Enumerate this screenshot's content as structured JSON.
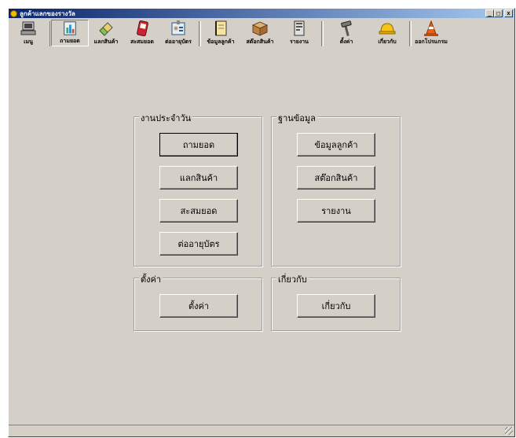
{
  "window": {
    "title": "ลูกค้าแลกของรางวัล",
    "controls": {
      "minimize": "_",
      "maximize": "□",
      "close": "x"
    }
  },
  "toolbar": {
    "items": [
      {
        "label": "เมนู",
        "icon": "computer-icon"
      },
      {
        "label": "ถามยอด",
        "icon": "chart-icon"
      },
      {
        "label": "แลกสินค้า",
        "icon": "eraser-icon"
      },
      {
        "label": "สะสมยอด",
        "icon": "pda-icon"
      },
      {
        "label": "ต่ออายุบัตร",
        "icon": "id-card-icon"
      },
      {
        "label": "ข้อมูลลูกค้า",
        "icon": "notebook-icon"
      },
      {
        "label": "สต๊อกสินค้า",
        "icon": "box-icon"
      },
      {
        "label": "รายงาน",
        "icon": "report-icon"
      },
      {
        "label": "ตั้งค่า",
        "icon": "hammer-icon"
      },
      {
        "label": "เกี่ยวกับ",
        "icon": "hardhat-icon"
      },
      {
        "label": "ออกโปรแกรม",
        "icon": "cone-icon"
      }
    ]
  },
  "groups": {
    "daily": {
      "title": "งานประจำวัน",
      "buttons": [
        "ถามยอด",
        "แลกสินค้า",
        "สะสมยอด",
        "ต่ออายุบัตร"
      ]
    },
    "database": {
      "title": "ฐานข้อมูล",
      "buttons": [
        "ข้อมูลลูกค้า",
        "สต๊อกสินค้า",
        "รายงาน"
      ]
    },
    "settings": {
      "title": "ตั้งค่า",
      "buttons": [
        "ตั้งค่า"
      ]
    },
    "about": {
      "title": "เกี่ยวกับ",
      "buttons": [
        "เกี่ยวกับ"
      ]
    }
  }
}
